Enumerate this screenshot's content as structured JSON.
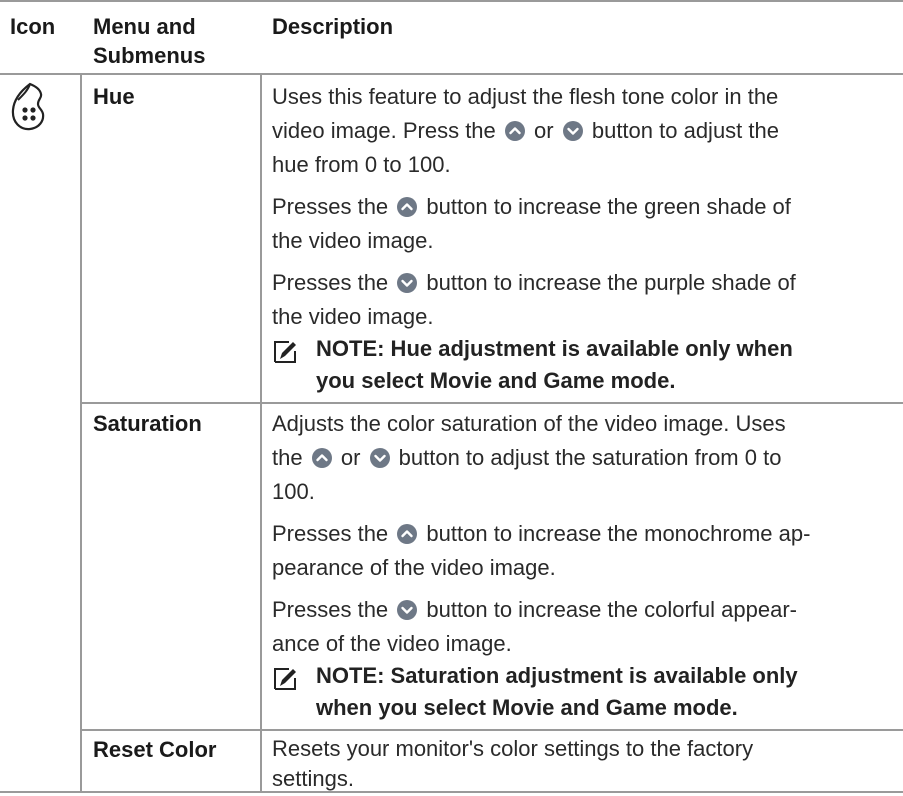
{
  "header": {
    "icon": "Icon",
    "menu": "Menu and Submenus",
    "description": "Description"
  },
  "icons": {
    "palette": "color-palette-icon",
    "note": "note-pencil-icon",
    "up": "up-button-icon",
    "down": "down-button-icon"
  },
  "hue": {
    "label": "Hue",
    "p1_a": "Uses this feature to adjust the flesh tone color in the",
    "p1_b": "video image. Press the",
    "p1_or": "or",
    "p1_c": "button to adjust the",
    "p1_d": "hue from 0 to 100.",
    "p2_a": "Presses the",
    "p2_b": "button to increase the green shade of",
    "p2_c": "the video image.",
    "p3_a": "Presses the",
    "p3_b": "button to increase the purple shade of",
    "p3_c": "the video image.",
    "note_a": "NOTE: Hue adjustment is available only when",
    "note_b": "you select Movie and Game mode."
  },
  "saturation": {
    "label": "Saturation",
    "p1_a": "Adjusts the color saturation of the video image. Uses",
    "p1_b": "the",
    "p1_or": "or",
    "p1_c": "button to adjust the saturation from 0 to",
    "p1_d": "100.",
    "p2_a": "Presses the",
    "p2_b": "button to increase the monochrome ap-",
    "p2_c": "pearance of the video image.",
    "p3_a": "Presses the",
    "p3_b": "button to increase the colorful appear-",
    "p3_c": "ance of the video image.",
    "note_a": "NOTE: Saturation adjustment is available only",
    "note_b": "when you select Movie and Game mode."
  },
  "reset": {
    "label": "Reset Color",
    "p1_a": "Resets your monitor's color settings to the factory",
    "p1_b": "settings."
  }
}
